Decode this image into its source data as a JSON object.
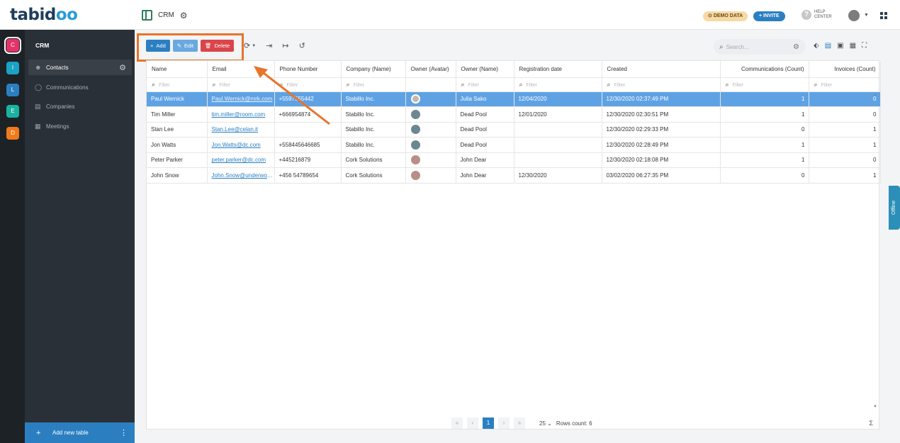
{
  "brand": {
    "logo_prefix": "tabid",
    "logo_oo": "oo"
  },
  "header": {
    "app_name": "CRM",
    "demo_label": "DEMO DATA",
    "invite_label": "INVITE",
    "help_line1": "HELP",
    "help_line2": "CENTER"
  },
  "rail": [
    {
      "letter": "C",
      "color": "#e5336a"
    },
    {
      "letter": "I",
      "color": "#1aa3c4"
    },
    {
      "letter": "L",
      "color": "#2b7fc1"
    },
    {
      "letter": "E",
      "color": "#1bb3a0"
    },
    {
      "letter": "D",
      "color": "#f07a1c"
    }
  ],
  "sidebar": {
    "title": "CRM",
    "items": [
      {
        "label": "Contacts"
      },
      {
        "label": "Communications"
      },
      {
        "label": "Companies"
      },
      {
        "label": "Meetings"
      }
    ],
    "add_table": "Add new table"
  },
  "toolbar": {
    "add": "Add",
    "edit": "Edit",
    "delete": "Delete"
  },
  "search": {
    "placeholder": "Search..."
  },
  "table": {
    "filter_placeholder": "Filter",
    "columns": [
      "Name",
      "Email",
      "Phone Number",
      "Company (Name)",
      "Owner (Avatar)",
      "Owner (Name)",
      "Registration date",
      "Created",
      "Communications (Count)",
      "Invoices (Count)"
    ],
    "rows": [
      [
        "Paul Wernick",
        "Paul.Wernick@mrk.com",
        "+5597555442",
        "Stabillo Inc.",
        "",
        "Julia Sako",
        "12/04/2020",
        "12/30/2020 02:37:49 PM",
        "1",
        "0"
      ],
      [
        "Tim Miller",
        "tim.miller@room.com",
        "+666954874",
        "Stabillo Inc.",
        "",
        "Dead Pool",
        "12/01/2020",
        "12/30/2020 02:30:51 PM",
        "1",
        "0"
      ],
      [
        "Stan Lee",
        "Stan.Lee@celan.it",
        "",
        "Stabillo Inc.",
        "",
        "Dead Pool",
        "",
        "12/30/2020 02:29:33 PM",
        "0",
        "1"
      ],
      [
        "Jon Watts",
        "Jon.Watts@dc.com",
        "+558445646685",
        "Stabillo Inc.",
        "",
        "Dead Pool",
        "",
        "12/30/2020 02:28:49 PM",
        "1",
        "1"
      ],
      [
        "Peter Parker",
        "peter.parker@dc.com",
        "+445216879",
        "Cork Solutions",
        "",
        "John Dear",
        "",
        "12/30/2020 02:18:08 PM",
        "1",
        "0"
      ],
      [
        "John Snow",
        "John.Snow@underworld.com",
        "+456 54789654",
        "Cork Solutions",
        "",
        "John Dear",
        "12/30/2020",
        "03/02/2020 06:27:35 PM",
        "0",
        "1"
      ]
    ],
    "selected_row": 0
  },
  "pager": {
    "current_page": "1",
    "page_size": "25",
    "rows_count": "Rows count: 6",
    "sigma": "Σ"
  },
  "offline_label": "Offline",
  "colors": {
    "accent": "#2b7fc1",
    "highlight": "#e8742a",
    "delete": "#d9454a",
    "selected_row": "#5ea2e4"
  }
}
